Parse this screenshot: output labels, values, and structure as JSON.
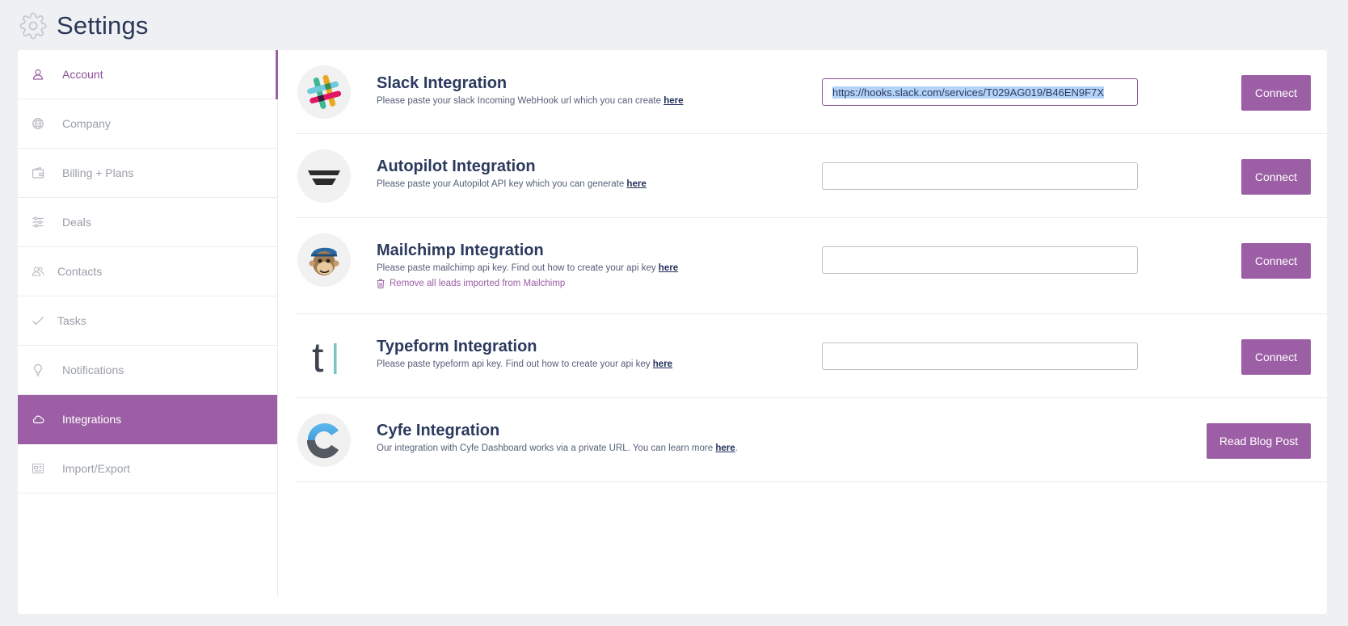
{
  "header": {
    "title": "Settings",
    "icon": "gear-icon"
  },
  "sidebar": {
    "items": [
      {
        "label": "Account",
        "icon": "user-icon"
      },
      {
        "label": "Company",
        "icon": "globe-icon"
      },
      {
        "label": "Billing + Plans",
        "icon": "wallet-icon"
      },
      {
        "label": "Deals",
        "icon": "sliders-icon"
      },
      {
        "label": "Contacts",
        "icon": "users-icon"
      },
      {
        "label": "Tasks",
        "icon": "check-icon"
      },
      {
        "label": "Notifications",
        "icon": "lightbulb-icon"
      },
      {
        "label": "Integrations",
        "icon": "cloud-icon"
      },
      {
        "label": "Import/Export",
        "icon": "document-icon"
      }
    ],
    "active_text_index": 0,
    "selected_index": 7
  },
  "integrations": [
    {
      "title": "Slack Integration",
      "description": "Please paste your slack Incoming WebHook url which you can create ",
      "link": "here",
      "value": "https://hooks.slack.com/services/T029AG019/B46EN9F7X",
      "button": "Connect"
    },
    {
      "title": "Autopilot Integration",
      "description": "Please paste your Autopilot API key which you can generate ",
      "link": "here",
      "value": "",
      "button": "Connect"
    },
    {
      "title": "Mailchimp Integration",
      "description": "Please paste mailchimp api key. Find out how to create your api key ",
      "link": "here",
      "remove_label": "Remove all leads imported from Mailchimp",
      "value": "",
      "button": "Connect"
    },
    {
      "title": "Typeform Integration",
      "description": "Please paste typeform api key. Find out how to create your api key ",
      "link": "here",
      "value": "",
      "button": "Connect"
    },
    {
      "title": "Cyfe Integration",
      "description": "Our integration with Cyfe Dashboard works via a private URL. You can learn more ",
      "link": "here",
      "suffix": ".",
      "button": "Read Blog Post"
    }
  ],
  "colors": {
    "accent": "#9c5fa5",
    "text": "#2b3a5e",
    "background": "#eff0f3"
  }
}
